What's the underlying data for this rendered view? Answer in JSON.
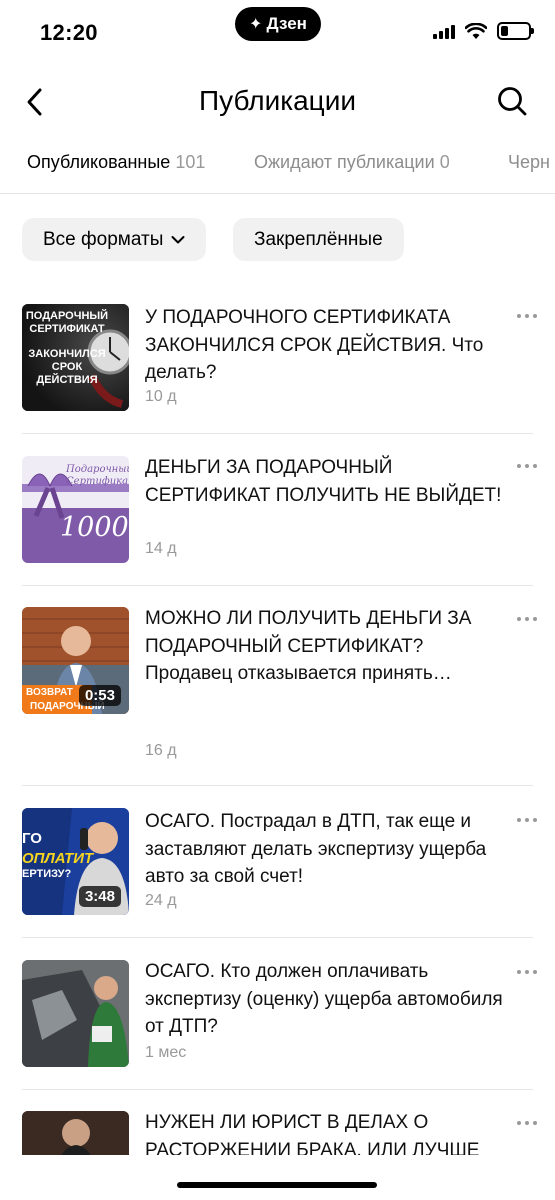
{
  "status_bar": {
    "time": "12:20",
    "app_pill": "Дзен",
    "battery_level_percent": 25
  },
  "header": {
    "title": "Публикации"
  },
  "tabs": [
    {
      "label": "Опубликованные",
      "count": "101"
    },
    {
      "label": "Ожидают публикации",
      "count": "0"
    },
    {
      "label": "Черн"
    }
  ],
  "filters": {
    "formats_label": "Все форматы",
    "pinned_label": "Закреплённые"
  },
  "posts": [
    {
      "title": "У ПОДАРОЧНОГО СЕРТИФИКАТА ЗАКОНЧИЛСЯ СРОК ДЕЙСТВИЯ. Что делать?",
      "date": "10 д",
      "thumb_text": [
        "ПОДАРОЧНЫЙ",
        "СЕРТИФИКАТ",
        "ЗАКОНЧИЛСЯ",
        "СРОК",
        "ДЕЙСТВИЯ"
      ]
    },
    {
      "title": "ДЕНЬГИ ЗА ПОДАРОЧНЫЙ СЕРТИФИКАТ ПОЛУЧИТЬ НЕ ВЫЙДЕТ!",
      "date": "14 д",
      "thumb_text": [
        "Подарочный",
        "Сертификат",
        "1000"
      ]
    },
    {
      "title": "МОЖНО ЛИ ПОЛУЧИТЬ ДЕНЬГИ ЗА ПОДАРОЧНЫЙ СЕРТИФИКАТ? Продавец отказывается принять…",
      "date": "16 д",
      "duration": "0:53",
      "thumb_text": [
        "ВОЗВРАТ",
        "ПОДАРОЧНЫЙ"
      ]
    },
    {
      "title": "ОСАГО. Пострадал в ДТП, так еще и заставляют делать экспертизу ущерба авто за свой счет!",
      "date": "24 д",
      "duration": "3:48",
      "thumb_text": [
        "ГО",
        "ОПЛАТИТ",
        "ЕРТИЗУ?"
      ]
    },
    {
      "title": "ОСАГО. Кто должен оплачивать экспертизу (оценку) ущерба автомобиля от ДТП?",
      "date": "1 мес"
    },
    {
      "title": "НУЖЕН ЛИ ЮРИСТ В ДЕЛАХ О РАСТОРЖЕНИИ БРАКА, ИЛИ ЛУЧШЕ",
      "date": ""
    }
  ],
  "colors": {
    "chip_bg": "#f1f1f2",
    "secondary_text": "#999999",
    "divider": "#e6e6e6"
  }
}
